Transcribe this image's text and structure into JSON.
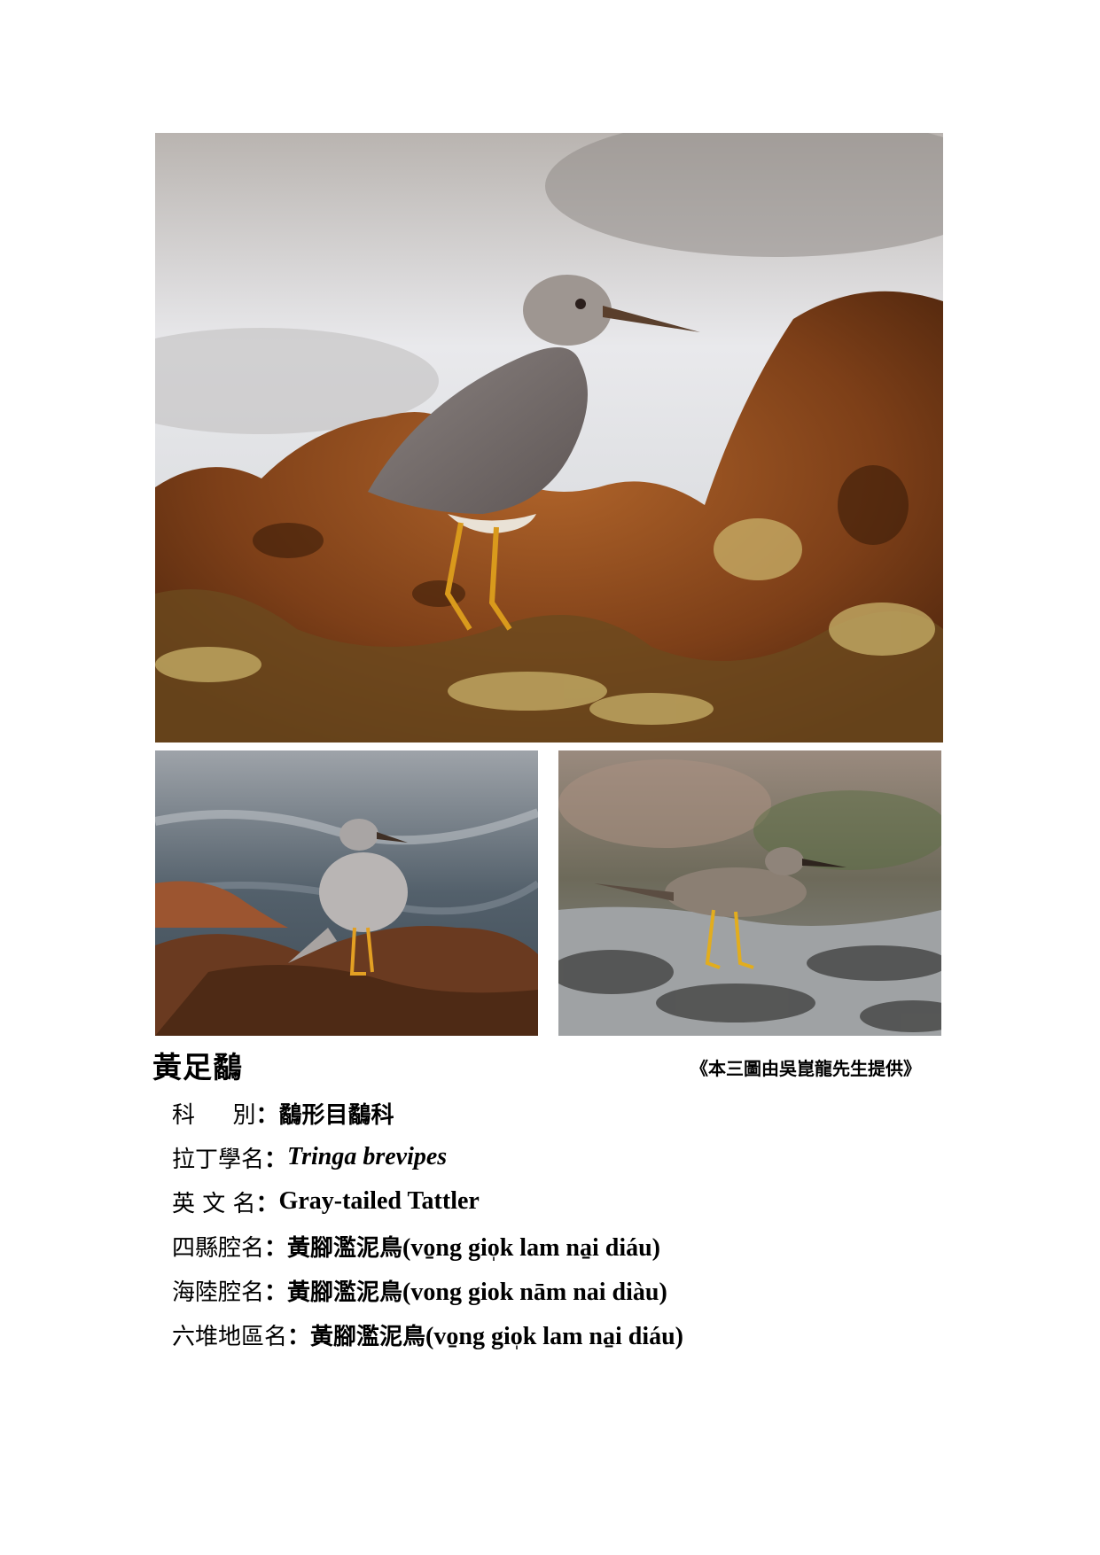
{
  "title": "黃足鷸",
  "credit": "《本三圖由吳崑龍先生提供》",
  "fields": [
    {
      "label": "科 　 別",
      "value_cjk": "鷸形目鷸科",
      "value_latin": ""
    },
    {
      "label": "拉丁學名",
      "value_cjk": "",
      "value_latin": "Tringa brevipes"
    },
    {
      "label": "英 文 名",
      "value_cjk": "",
      "value_latin": "Gray-tailed Tattler"
    },
    {
      "label": "四縣腔名",
      "value_cjk": "黃腳濫泥鳥",
      "value_latin": "(vo̱ng gio̩k lam na̱i diáu)"
    },
    {
      "label": "海陸腔名",
      "value_cjk": "黃腳濫泥鳥",
      "value_latin": "(vong giok nām nai diàu)"
    },
    {
      "label": "六堆地區名",
      "value_cjk": "黃腳濫泥鳥",
      "value_latin": "(vo̱ng gio̩k lam na̱i diáu)"
    }
  ],
  "separator": "：",
  "photos": {
    "main": "bird-on-rock-photo",
    "left": "bird-on-rock-by-sea-photo",
    "right": "bird-on-wet-rock-photo"
  }
}
